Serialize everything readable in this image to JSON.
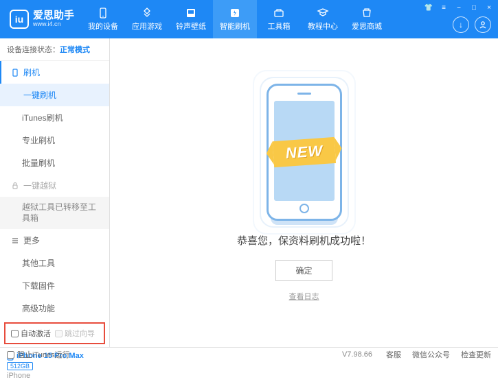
{
  "header": {
    "logo_mark": "iu",
    "logo_title": "爱思助手",
    "logo_url": "www.i4.cn",
    "nav": [
      {
        "label": "我的设备"
      },
      {
        "label": "应用游戏"
      },
      {
        "label": "铃声壁纸"
      },
      {
        "label": "智能刷机"
      },
      {
        "label": "工具箱"
      },
      {
        "label": "教程中心"
      },
      {
        "label": "爱思商城"
      }
    ]
  },
  "sidebar": {
    "status_label": "设备连接状态：",
    "status_mode": "正常模式",
    "section_flash": "刷机",
    "items_flash": [
      "一键刷机",
      "iTunes刷机",
      "专业刷机",
      "批量刷机"
    ],
    "section_jailbreak": "一键越狱",
    "jailbreak_note": "越狱工具已转移至工具箱",
    "section_more": "更多",
    "items_more": [
      "其他工具",
      "下载固件",
      "高级功能"
    ],
    "auto_activate": "自动激活",
    "skip_guide": "跳过向导",
    "device_name": "iPhone 15 Pro Max",
    "storage": "512GB",
    "device_type": "iPhone"
  },
  "main": {
    "new_badge": "NEW",
    "success_msg": "恭喜您，保资料刷机成功啦！",
    "ok_button": "确定",
    "log_link": "查看日志"
  },
  "footer": {
    "block_itunes": "阻止iTunes运行",
    "version": "V7.98.66",
    "links": [
      "客服",
      "微信公众号",
      "检查更新"
    ]
  }
}
